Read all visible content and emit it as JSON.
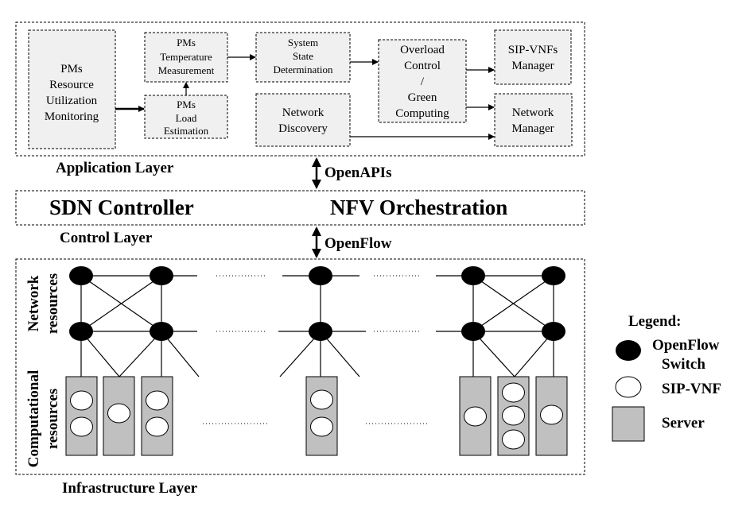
{
  "application_layer": {
    "label": "Application Layer",
    "boxes": {
      "resource_monitoring": [
        "PMs",
        "Resource",
        "Utilization",
        "Monitoring"
      ],
      "temperature": [
        "PMs",
        "Temperature",
        "Measurement"
      ],
      "load": [
        "PMs",
        "Load",
        "Estimation"
      ],
      "system_state": [
        "System",
        "State",
        "Determination"
      ],
      "network_discovery": [
        "Network",
        "Discovery"
      ],
      "overload": [
        "Overload",
        "Control",
        "/",
        "Green",
        "Computing"
      ],
      "sip_vnfs_manager": [
        "SIP-VNFs",
        "Manager"
      ],
      "network_manager": [
        "Network",
        "Manager"
      ]
    }
  },
  "interfaces": {
    "north": "OpenAPIs",
    "south": "OpenFlow"
  },
  "control_layer": {
    "label": "Control Layer",
    "sdn": "SDN Controller",
    "nfv": "NFV Orchestration"
  },
  "infrastructure_layer": {
    "label": "Infrastructure Layer",
    "network_resources": [
      "Network",
      "resources"
    ],
    "computational_resources": [
      "Computational",
      "resources"
    ]
  },
  "legend": {
    "title": "Legend:",
    "switch": [
      "OpenFlow",
      "Switch"
    ],
    "vnf": "SIP-VNF",
    "server": "Server"
  },
  "colors": {
    "switch": "#000000",
    "server": "#c0c0c0",
    "box": "#f0f0f0"
  }
}
